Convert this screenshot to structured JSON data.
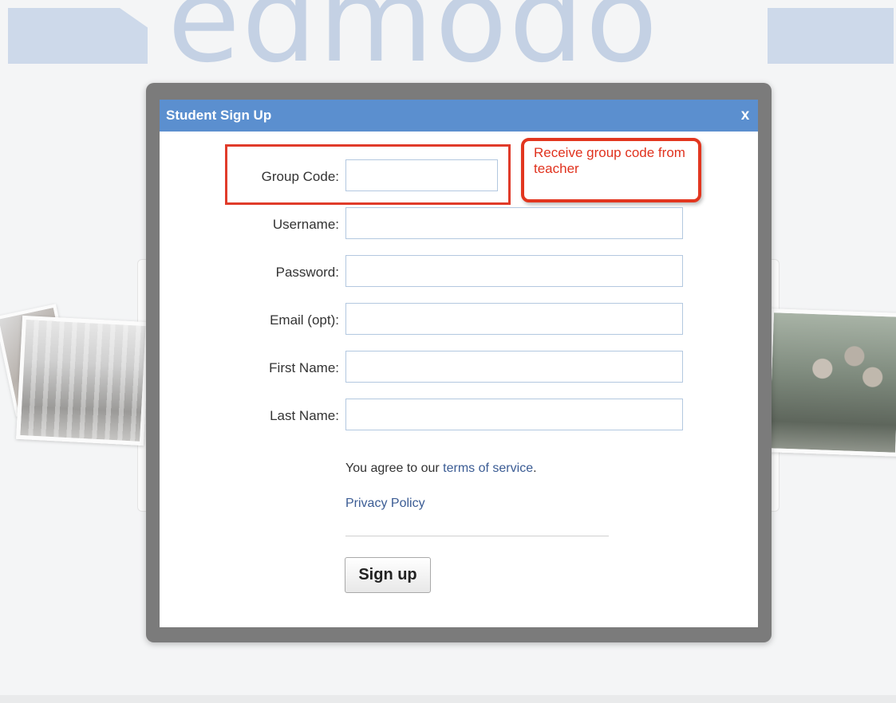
{
  "background": {
    "logo_text": "edmodo"
  },
  "modal": {
    "title": "Student Sign Up",
    "close_label": "x"
  },
  "form": {
    "fields": [
      {
        "label": "Group Code:",
        "value": ""
      },
      {
        "label": "Username:",
        "value": ""
      },
      {
        "label": "Password:",
        "value": ""
      },
      {
        "label": "Email (opt):",
        "value": ""
      },
      {
        "label": "First Name:",
        "value": ""
      },
      {
        "label": "Last Name:",
        "value": ""
      }
    ],
    "agree_prefix": "You agree to our ",
    "terms_link": "terms of service",
    "agree_suffix": ".",
    "privacy_link": "Privacy Policy",
    "submit_label": "Sign up"
  },
  "annotation": {
    "callout_text": "Receive group code from teacher",
    "highlight_color": "#e0321e"
  },
  "colors": {
    "header_blue": "#5b8fcf",
    "link_blue": "#3b5c94",
    "frame_gray": "#7b7b7b"
  }
}
